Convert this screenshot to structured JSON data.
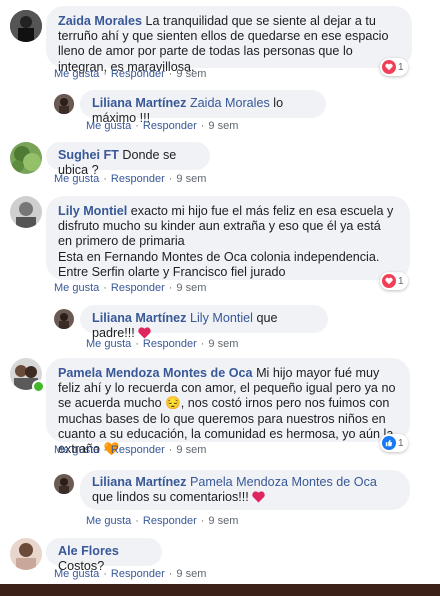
{
  "actions": {
    "like": "Me gusta",
    "reply": "Responder",
    "dot": "·"
  },
  "comments": [
    {
      "author": "Zaida Morales",
      "text": "La tranquilidad que se siente al dejar a tu terruño ahí y que sienten ellos de quedarse en ese espacio lleno de amor por parte de todas las personas que lo integran, es maravillosa.",
      "time": "9 sem",
      "reaction": {
        "icon": "heart-reaction-icon",
        "count": "1"
      }
    },
    {
      "author": "Liliana Martínez",
      "mention": "Zaida Morales",
      "text": "lo máximo !!!",
      "time": "9 sem"
    },
    {
      "author": "Sughei FT",
      "text": "Donde se ubica ?",
      "time": "9 sem"
    },
    {
      "author": "Lily Montiel",
      "text": "exacto mi hijo fue el más feliz en esa escuela y disfruto mucho su kinder aun extraña y eso que él ya está en primero de primaria",
      "text2": "Esta en Fernando Montes de Oca colonia independencia. Entre Serfin olarte y Francisco fiel jurado",
      "time": "9 sem",
      "reaction": {
        "icon": "heart-reaction-icon",
        "count": "1"
      }
    },
    {
      "author": "Liliana Martínez",
      "mention": "Lily Montiel",
      "text": "que padre!!!",
      "time": "9 sem"
    },
    {
      "author": "Pamela Mendoza Montes de Oca",
      "text": "Mi hijo mayor fué muy feliz ahí y lo recuerda con amor, el pequeño igual pero ya no se acuerda mucho 😔, nos costó irnos pero nos fuimos con muchas bases de lo que queremos para nuestros niños en cuanto a su educación, la comunidad es hermosa, yo aún la extraño 🧡",
      "time": "9 sem",
      "reaction": {
        "icon": "like-reaction-icon",
        "count": "1"
      }
    },
    {
      "author": "Liliana Martínez",
      "mention": "Pamela Mendoza Montes de Oca",
      "text": "que lindos su comentarios!!!",
      "time": "9 sem"
    },
    {
      "author": "Ale Flores",
      "text": "Costos?",
      "time": "9 sem"
    }
  ],
  "colors": {
    "link": "#385898",
    "bubble": "#f0f2f5",
    "heart": "#f33e58",
    "like": "#1877f2",
    "meta": "#606770"
  }
}
